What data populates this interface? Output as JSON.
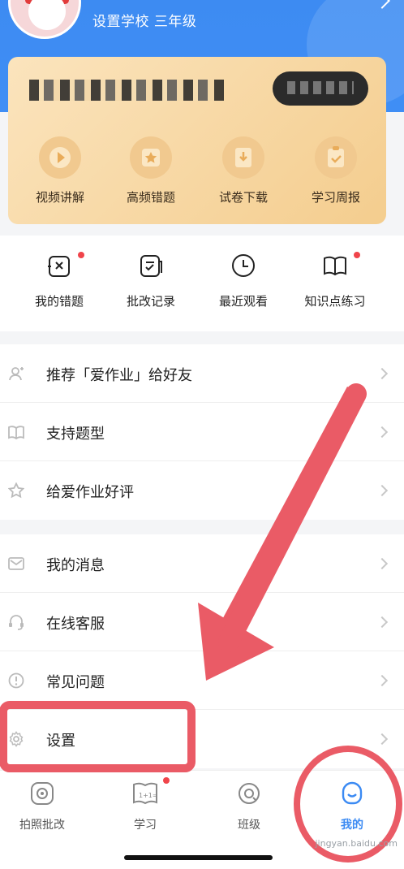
{
  "header": {
    "school_grade": "设置学校 三年级"
  },
  "vip_card": {
    "items": [
      {
        "label": "视频讲解",
        "icon": "play-icon"
      },
      {
        "label": "高频错题",
        "icon": "star-icon"
      },
      {
        "label": "试卷下载",
        "icon": "download-icon"
      },
      {
        "label": "学习周报",
        "icon": "report-icon"
      }
    ]
  },
  "tools": {
    "items": [
      {
        "label": "我的错题",
        "icon": "wrong-question-icon",
        "badge": true
      },
      {
        "label": "批改记录",
        "icon": "correction-record-icon",
        "badge": false
      },
      {
        "label": "最近观看",
        "icon": "clock-icon",
        "badge": false
      },
      {
        "label": "知识点练习",
        "icon": "book-icon",
        "badge": true
      }
    ]
  },
  "list1": [
    {
      "label": "推荐「爱作业」给好友",
      "icon": "share-user-icon"
    },
    {
      "label": "支持题型",
      "icon": "open-book-icon"
    },
    {
      "label": "给爱作业好评",
      "icon": "star-outline-icon"
    }
  ],
  "list2": [
    {
      "label": "我的消息",
      "icon": "mail-icon"
    },
    {
      "label": "在线客服",
      "icon": "headset-icon"
    },
    {
      "label": "常见问题",
      "icon": "info-icon"
    },
    {
      "label": "设置",
      "icon": "gear-icon"
    }
  ],
  "tabbar": {
    "items": [
      {
        "label": "拍照批改",
        "icon": "camera-icon",
        "active": false
      },
      {
        "label": "学习",
        "icon": "study-icon",
        "active": false,
        "badge": true
      },
      {
        "label": "班级",
        "icon": "class-icon",
        "active": false
      },
      {
        "label": "我的",
        "icon": "profile-icon",
        "active": true
      }
    ]
  },
  "colors": {
    "header_blue": "#3f8ef5",
    "accent_blue": "#3b8af3",
    "badge_red": "#f0444a",
    "annotation_red": "#ea5b66"
  },
  "watermark": "jingyan.baidu.com"
}
